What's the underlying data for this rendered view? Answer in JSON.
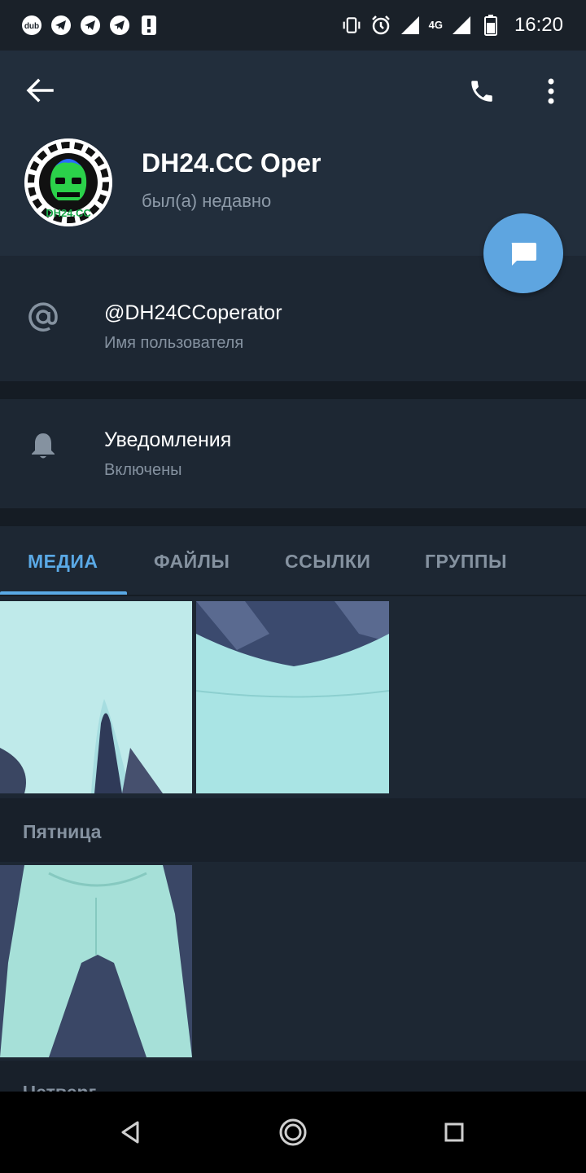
{
  "status_bar": {
    "time": "16:20",
    "network": "4G",
    "left_icons": [
      "dub-icon",
      "telegram-icon",
      "telegram-icon",
      "telegram-icon",
      "alert-icon"
    ],
    "right_icons": [
      "vibrate-icon",
      "alarm-icon",
      "signal-icon",
      "network-4g",
      "signal-icon",
      "battery-icon"
    ]
  },
  "header": {
    "name": "DH24.CC Oper",
    "status": "был(а) недавно",
    "avatar_text": "DH24.CC"
  },
  "username_row": {
    "value": "@DH24CCoperator",
    "label": "Имя пользователя"
  },
  "notifications_row": {
    "title": "Уведомления",
    "value": "Включены"
  },
  "tabs": [
    {
      "label": "МЕДИА",
      "active": true
    },
    {
      "label": "ФАЙЛЫ",
      "active": false
    },
    {
      "label": "ССЫЛКИ",
      "active": false
    },
    {
      "label": "ГРУППЫ",
      "active": false
    }
  ],
  "media_sections": [
    {
      "date": "",
      "items": 2
    },
    {
      "date": "Пятница",
      "items": 1
    },
    {
      "date": "Четверг",
      "items": 0
    }
  ],
  "colors": {
    "accent": "#5aa9e6",
    "header_bg": "#222e3c",
    "body_bg": "#1d2733",
    "fab": "#5ea5e0"
  }
}
